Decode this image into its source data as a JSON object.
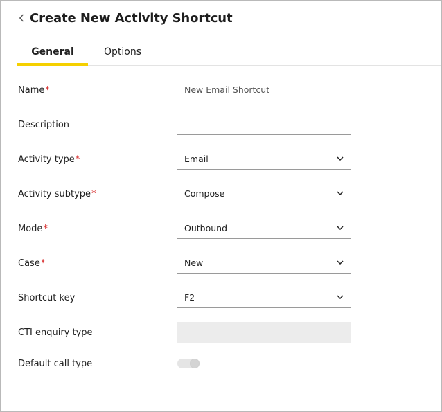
{
  "header": {
    "title": "Create New Activity Shortcut"
  },
  "tabs": [
    {
      "label": "General",
      "active": true
    },
    {
      "label": "Options",
      "active": false
    }
  ],
  "colors": {
    "tab_accent": "#f5d000",
    "required": "#d62424"
  },
  "form": {
    "name": {
      "label": "Name",
      "required": true,
      "value": "New Email Shortcut"
    },
    "description": {
      "label": "Description",
      "required": false,
      "value": ""
    },
    "activity_type": {
      "label": "Activity type",
      "required": true,
      "value": "Email"
    },
    "activity_subtype": {
      "label": "Activity subtype",
      "required": true,
      "value": "Compose"
    },
    "mode": {
      "label": "Mode",
      "required": true,
      "value": "Outbound"
    },
    "case": {
      "label": "Case",
      "required": true,
      "value": "New"
    },
    "shortcut_key": {
      "label": "Shortcut key",
      "required": false,
      "value": "F2"
    },
    "cti_enquiry_type": {
      "label": "CTI enquiry type",
      "required": false,
      "value": "",
      "disabled": true
    },
    "default_call_type": {
      "label": "Default call type",
      "toggle": "disabled"
    }
  },
  "required_marker": "*"
}
